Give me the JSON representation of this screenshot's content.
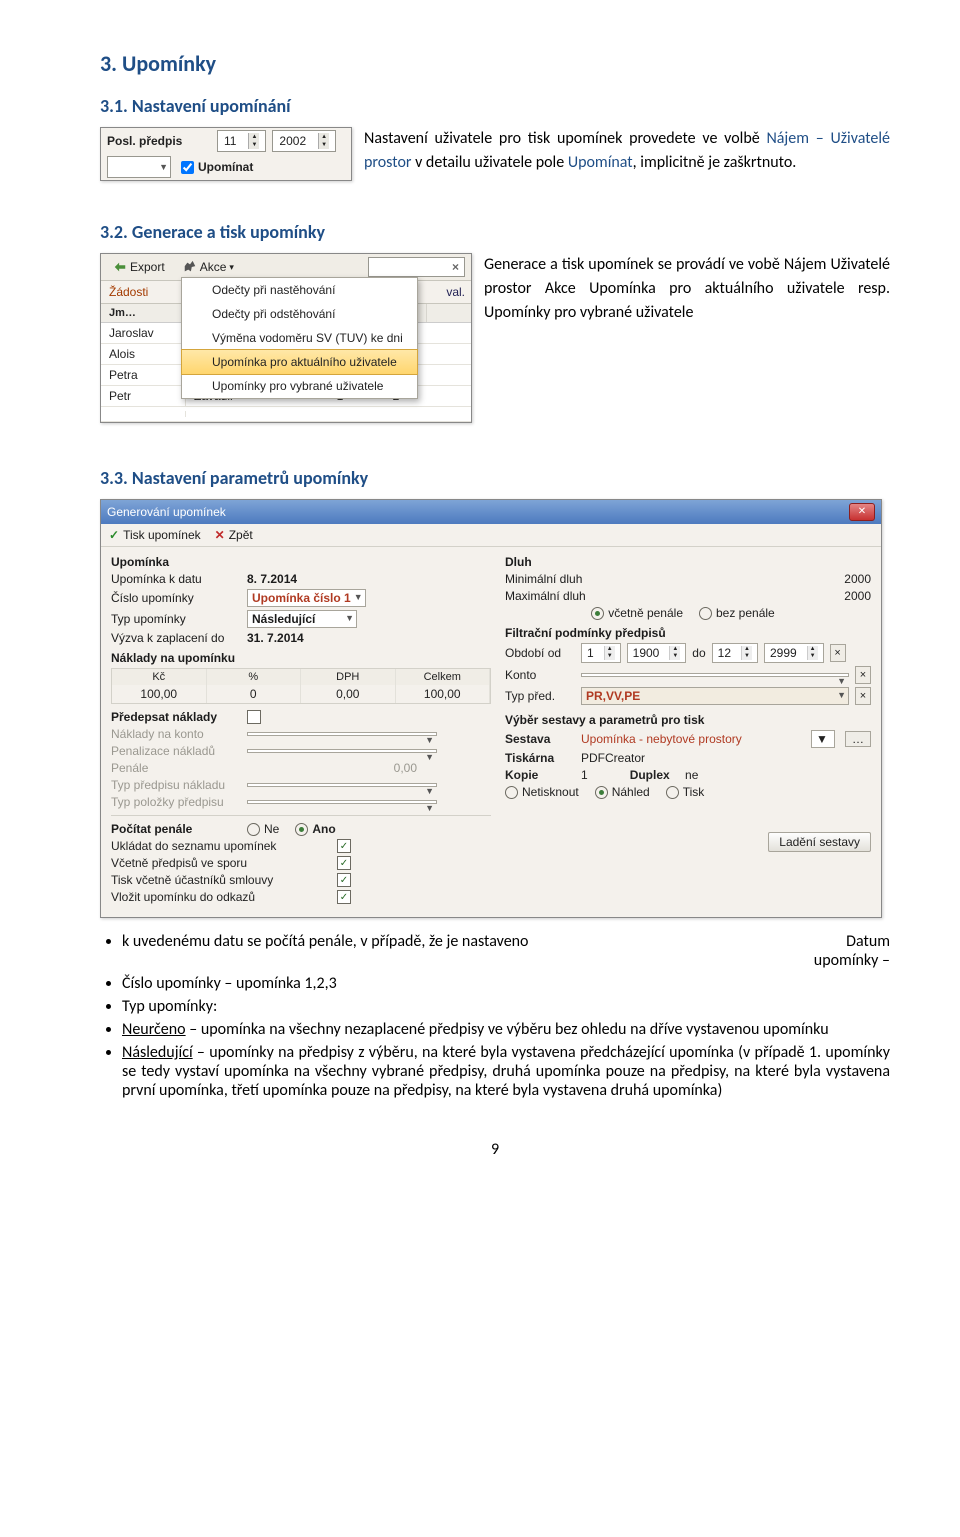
{
  "h_s3": "3. Upomínky",
  "h_s31": "3.1. Nastavení upomínání",
  "h_s32": "3.2. Generace a tisk upomínky",
  "h_s33": "3.3. Nastavení parametrů upomínky",
  "p31": {
    "pre": "Nastavení uživatele pro tisk upomínek provedete ve volbě ",
    "link1": "Nájem – Uživatelé prostor",
    "mid": " v detailu uživatele pole ",
    "link2": "Upomínat",
    "post": ", implicitně je zaškrtnuto."
  },
  "p32": {
    "pre": "Generace a tisk upomínek se provádí ve vobě Nájem Uživatelé prostor Akce Upomínka pro aktuálního uživatele resp. Upomínky pro vybrané uživatele"
  },
  "ss1": {
    "label": "Posl. předpis",
    "month": "11",
    "year": "2002",
    "chk_label": "Upomínat"
  },
  "ss2": {
    "export": "Export",
    "akce": "Akce",
    "search": "",
    "tabs": [
      "Žádosti",
      "",
      "val."
    ],
    "hdr": [
      "Jm…",
      "",
      "",
      "",
      ""
    ],
    "rows": [
      {
        "name": "Jaroslav"
      },
      {
        "name": "Alois"
      },
      {
        "name": "Petra"
      },
      {
        "name": "Petr",
        "col1": "Zavadil",
        "a": "1",
        "b": "2"
      },
      {
        "name": "",
        "col1": "",
        "a": "",
        "b": ""
      }
    ],
    "menu": [
      "Odečty při nastěhování",
      "Odečty při odstěhování",
      "Výměna vodoměru SV (TUV) ke dni",
      "Upomínka pro aktuálního uživatele",
      "Upomínky pro vybrané uživatele"
    ]
  },
  "ss3": {
    "title": "Generování upomínek",
    "actions": {
      "tisk": "Tisk upomínek",
      "zpet": "Zpět"
    },
    "left": {
      "grp_upominka": "Upomínka",
      "upominka_k_datu_l": "Upomínka k datu",
      "upominka_k_datu_v": "8. 7.2014",
      "cislo_l": "Číslo upomínky",
      "cislo_v": "Upomínka číslo 1",
      "typ_l": "Typ upomínky",
      "typ_v": "Následující",
      "vyzva_l": "Výzva k zaplacení do",
      "vyzva_v": "31. 7.2014",
      "naklady_l": "Náklady na upomínku",
      "tbl_hdr": [
        "Kč",
        "%",
        "DPH",
        "Celkem"
      ],
      "tbl_row": [
        "100,00",
        "0",
        "0,00",
        "100,00"
      ],
      "predepsat_l": "Předepsat náklady",
      "naklady_konto_l": "Náklady na konto",
      "penalizace_l": "Penalizace nákladů",
      "penale_l": "Penále",
      "penale_v": "0,00",
      "typ_predpisu_l": "Typ předpisu nákladu",
      "typ_polozky_l": "Typ položky předpisu",
      "pocitat_l": "Počítat penále",
      "ne": "Ne",
      "ano": "Ano",
      "ukladat_l": "Ukládat do seznamu upomínek",
      "vcetne_l": "Včetně předpisů ve sporu",
      "tisk_vcetne_l": "Tisk včetně účastníků smlouvy",
      "vlozit_l": "Vložit upomínku do odkazů"
    },
    "right": {
      "dluh_l": "Dluh",
      "min_l": "Minimální dluh",
      "min_v": "2000",
      "max_l": "Maximální dluh",
      "max_v": "2000",
      "vcetne_penale": "včetně penále",
      "bez_penale": "bez penále",
      "filtr_l": "Filtrační podmínky předpisů",
      "obdobi_l": "Období od",
      "m1": "1",
      "y1": "1900",
      "do": "do",
      "m2": "12",
      "y2": "2999",
      "konto_l": "Konto",
      "typ_pred_l": "Typ před.",
      "typ_pred_v": "PR,VV,PE",
      "vyber_l": "Výběr sestavy a parametrů pro tisk",
      "sestava_l": "Sestava",
      "sestava_v": "Upomínka - nebytové prostory",
      "tiskarna_l": "Tiskárna",
      "tiskarna_v": "PDFCreator",
      "kopie_l": "Kopie",
      "kopie_v": "1",
      "duplex_l": "Duplex",
      "duplex_v": "ne",
      "r_netisk": "Netisknout",
      "r_nahled": "Náhled",
      "r_tisk": "Tisk",
      "ladeni": "Ladění sestavy"
    }
  },
  "bullets": {
    "datum": "Datum",
    "upominky_dash": "upomínky – ",
    "b0_tail": "k uvedenému datu se počítá penále, v případě, že je nastaveno",
    "b1": "Číslo upomínky – upomínka 1,2,3",
    "b2": "Typ upomínky:",
    "b3_pre": "Neurčeno",
    "b3_post": " – upomínka na všechny nezaplacené předpisy ve výběru bez ohledu na dříve vystavenou upomínku",
    "b4_pre": "Následující",
    "b4_post": " – upomínky na předpisy z výběru, na které byla vystavena předcházející upomínka (v případě 1. upomínky se tedy vystaví upomínka na všechny vybrané předpisy, druhá upomínka pouze na předpisy, na které byla vystavena první upomínka, třetí upomínka pouze na předpisy, na které byla vystavena druhá upomínka)"
  },
  "pagenum": "9"
}
